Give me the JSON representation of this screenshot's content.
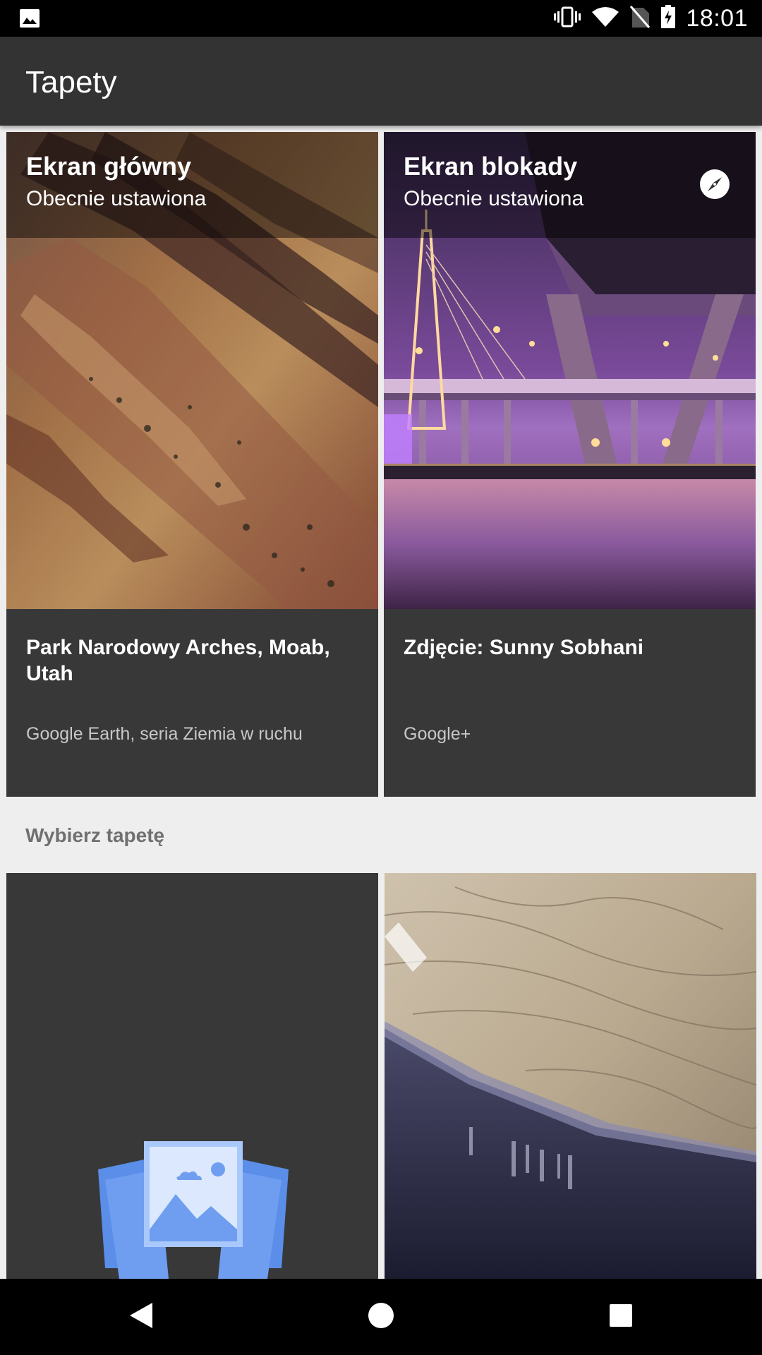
{
  "status_bar": {
    "time": "18:01",
    "icons": [
      "image-notification-icon",
      "vibrate-icon",
      "wifi-icon",
      "no-sim-icon",
      "battery-icon"
    ]
  },
  "app_bar": {
    "title": "Tapety"
  },
  "current": [
    {
      "screen": "Ekran główny",
      "state": "Obecnie ustawiona",
      "name": "Park Narodowy Arches, Moab, Utah",
      "source": "Google Earth, seria Ziemia w ruchu"
    },
    {
      "screen": "Ekran blokady",
      "state": "Obecnie ustawiona",
      "name": "Zdjęcie: Sunny Sobhani",
      "source": "Google+",
      "icon": "explore-compass-icon"
    }
  ],
  "section": {
    "label": "Wybierz tapetę"
  },
  "tiles": [
    {
      "icon": "my-photos-icon"
    },
    {
      "icon": "none"
    }
  ],
  "nav_bar": {
    "icons": [
      "back-icon",
      "home-icon",
      "recents-icon"
    ]
  },
  "colors": {
    "app_bar": "#333333",
    "background": "#eeeeee",
    "card": "#383838",
    "accent_blue": "#7baaf7"
  }
}
